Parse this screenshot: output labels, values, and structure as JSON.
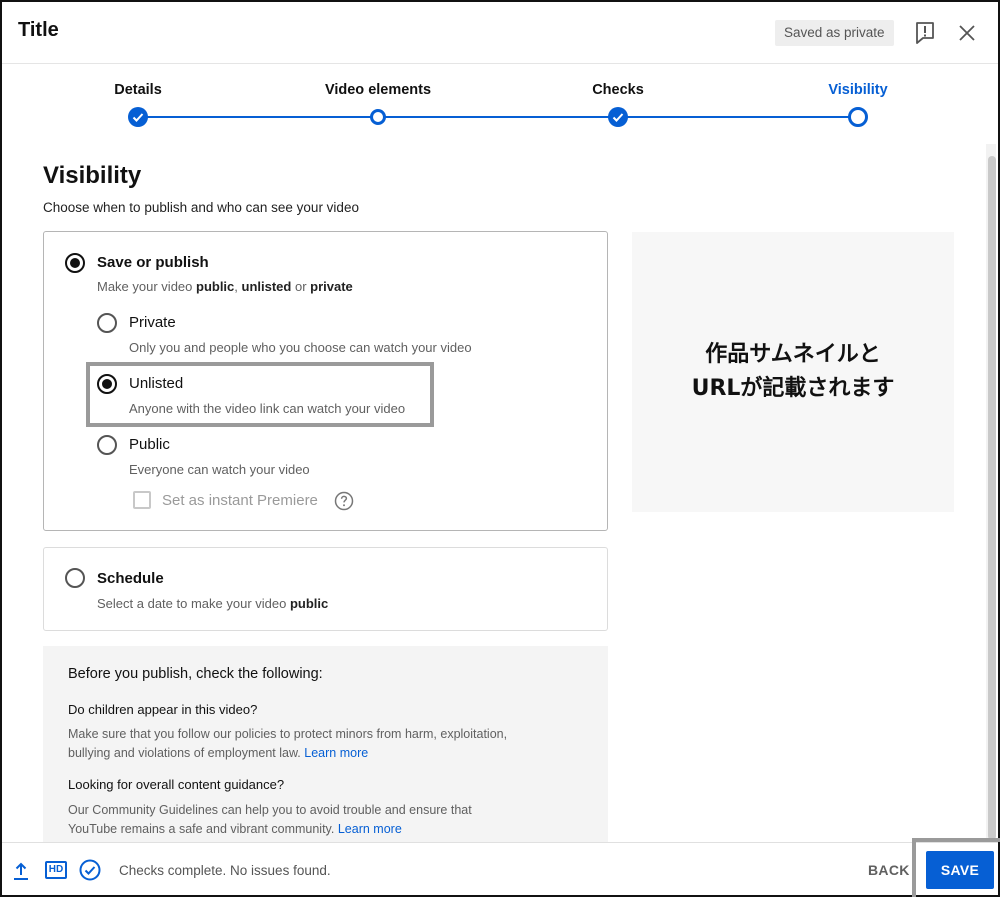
{
  "header": {
    "title": "Title",
    "saved_badge": "Saved as private"
  },
  "stepper": {
    "steps": [
      {
        "label": "Details",
        "state": "done"
      },
      {
        "label": "Video elements",
        "state": "open"
      },
      {
        "label": "Checks",
        "state": "done"
      },
      {
        "label": "Visibility",
        "state": "current"
      }
    ]
  },
  "main": {
    "heading": "Visibility",
    "subheading": "Choose when to publish and who can see your video",
    "save_or_publish": {
      "title": "Save or publish",
      "desc_prefix": "Make your video ",
      "desc_public": "public",
      "desc_sep1": ", ",
      "desc_unlisted": "unlisted",
      "desc_sep2": " or ",
      "desc_private": "private",
      "selected": true,
      "options": [
        {
          "label": "Private",
          "desc": "Only you and people who you choose can watch your video",
          "selected": false
        },
        {
          "label": "Unlisted",
          "desc": "Anyone with the video link can watch your video",
          "selected": true
        },
        {
          "label": "Public",
          "desc": "Everyone can watch your video",
          "selected": false
        }
      ],
      "premiere_label": "Set as instant Premiere"
    },
    "schedule": {
      "title": "Schedule",
      "desc_prefix": "Select a date to make your video ",
      "desc_bold": "public",
      "selected": false
    },
    "thumbnail_note": {
      "line1": "作品サムネイルと",
      "line2": "URLが記載されます"
    },
    "notice": {
      "title": "Before you publish, check the following:",
      "q1": "Do children appear in this video?",
      "p1": "Make sure that you follow our policies to protect minors from harm, exploitation, bullying and violations of employment law.",
      "p1_link": "Learn more",
      "q2": "Looking for overall content guidance?",
      "p2": "Our Community Guidelines can help you to avoid trouble and ensure that YouTube remains a safe and vibrant community.",
      "p2_link": "Learn more"
    }
  },
  "footer": {
    "hd_label": "HD",
    "status": "Checks complete. No issues found.",
    "back": "BACK",
    "save": "SAVE"
  },
  "colors": {
    "accent": "#065fd4",
    "highlight_border": "#9a9a9a"
  }
}
